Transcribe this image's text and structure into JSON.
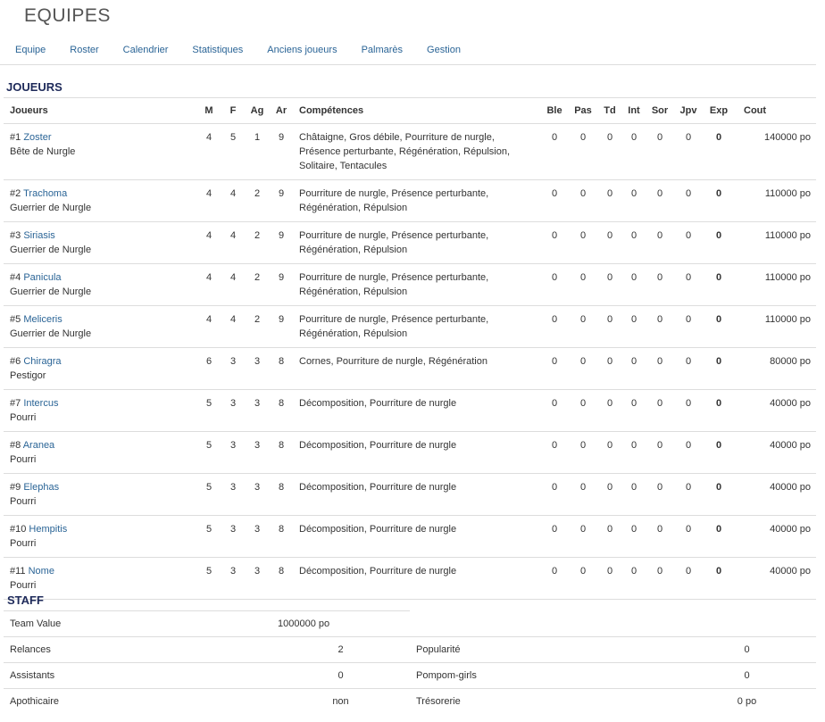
{
  "page": {
    "title": "EQUIPES"
  },
  "nav": {
    "items": [
      "Equipe",
      "Roster",
      "Calendrier",
      "Statistiques",
      "Anciens joueurs",
      "Palmarès",
      "Gestion"
    ]
  },
  "players_section": {
    "title": "JOUEURS",
    "headers": [
      "Joueurs",
      "M",
      "F",
      "Ag",
      "Ar",
      "Compétences",
      "Ble",
      "Pas",
      "Td",
      "Int",
      "Sor",
      "Jpv",
      "Exp",
      "Cout"
    ],
    "rows": [
      {
        "num": "#1",
        "name": "Zoster",
        "position": "Bête de Nurgle",
        "M": "4",
        "F": "5",
        "Ag": "1",
        "Ar": "9",
        "skills": "Châtaigne, Gros débile, Pourriture de nurgle, Présence perturbante, Régénération, Répulsion, Solitaire, Tentacules",
        "Ble": "0",
        "Pas": "0",
        "Td": "0",
        "Int": "0",
        "Sor": "0",
        "Jpv": "0",
        "Exp": "0",
        "cost": "140000 po"
      },
      {
        "num": "#2",
        "name": "Trachoma",
        "position": "Guerrier de Nurgle",
        "M": "4",
        "F": "4",
        "Ag": "2",
        "Ar": "9",
        "skills": "Pourriture de nurgle, Présence perturbante, Régénération, Répulsion",
        "Ble": "0",
        "Pas": "0",
        "Td": "0",
        "Int": "0",
        "Sor": "0",
        "Jpv": "0",
        "Exp": "0",
        "cost": "110000 po"
      },
      {
        "num": "#3",
        "name": "Siriasis",
        "position": "Guerrier de Nurgle",
        "M": "4",
        "F": "4",
        "Ag": "2",
        "Ar": "9",
        "skills": "Pourriture de nurgle, Présence perturbante, Régénération, Répulsion",
        "Ble": "0",
        "Pas": "0",
        "Td": "0",
        "Int": "0",
        "Sor": "0",
        "Jpv": "0",
        "Exp": "0",
        "cost": "110000 po"
      },
      {
        "num": "#4",
        "name": "Panicula",
        "position": "Guerrier de Nurgle",
        "M": "4",
        "F": "4",
        "Ag": "2",
        "Ar": "9",
        "skills": "Pourriture de nurgle, Présence perturbante, Régénération, Répulsion",
        "Ble": "0",
        "Pas": "0",
        "Td": "0",
        "Int": "0",
        "Sor": "0",
        "Jpv": "0",
        "Exp": "0",
        "cost": "110000 po"
      },
      {
        "num": "#5",
        "name": "Meliceris",
        "position": "Guerrier de Nurgle",
        "M": "4",
        "F": "4",
        "Ag": "2",
        "Ar": "9",
        "skills": "Pourriture de nurgle, Présence perturbante, Régénération, Répulsion",
        "Ble": "0",
        "Pas": "0",
        "Td": "0",
        "Int": "0",
        "Sor": "0",
        "Jpv": "0",
        "Exp": "0",
        "cost": "110000 po"
      },
      {
        "num": "#6",
        "name": "Chiragra",
        "position": "Pestigor",
        "M": "6",
        "F": "3",
        "Ag": "3",
        "Ar": "8",
        "skills": "Cornes, Pourriture de nurgle, Régénération",
        "Ble": "0",
        "Pas": "0",
        "Td": "0",
        "Int": "0",
        "Sor": "0",
        "Jpv": "0",
        "Exp": "0",
        "cost": "80000 po"
      },
      {
        "num": "#7",
        "name": "Intercus",
        "position": "Pourri",
        "M": "5",
        "F": "3",
        "Ag": "3",
        "Ar": "8",
        "skills": "Décomposition, Pourriture de nurgle",
        "Ble": "0",
        "Pas": "0",
        "Td": "0",
        "Int": "0",
        "Sor": "0",
        "Jpv": "0",
        "Exp": "0",
        "cost": "40000 po"
      },
      {
        "num": "#8",
        "name": "Aranea",
        "position": "Pourri",
        "M": "5",
        "F": "3",
        "Ag": "3",
        "Ar": "8",
        "skills": "Décomposition, Pourriture de nurgle",
        "Ble": "0",
        "Pas": "0",
        "Td": "0",
        "Int": "0",
        "Sor": "0",
        "Jpv": "0",
        "Exp": "0",
        "cost": "40000 po"
      },
      {
        "num": "#9",
        "name": "Elephas",
        "position": "Pourri",
        "M": "5",
        "F": "3",
        "Ag": "3",
        "Ar": "8",
        "skills": "Décomposition, Pourriture de nurgle",
        "Ble": "0",
        "Pas": "0",
        "Td": "0",
        "Int": "0",
        "Sor": "0",
        "Jpv": "0",
        "Exp": "0",
        "cost": "40000 po"
      },
      {
        "num": "#10",
        "name": "Hempitis",
        "position": "Pourri",
        "M": "5",
        "F": "3",
        "Ag": "3",
        "Ar": "8",
        "skills": "Décomposition, Pourriture de nurgle",
        "Ble": "0",
        "Pas": "0",
        "Td": "0",
        "Int": "0",
        "Sor": "0",
        "Jpv": "0",
        "Exp": "0",
        "cost": "40000 po"
      },
      {
        "num": "#11",
        "name": "Nome",
        "position": "Pourri",
        "M": "5",
        "F": "3",
        "Ag": "3",
        "Ar": "8",
        "skills": "Décomposition, Pourriture de nurgle",
        "Ble": "0",
        "Pas": "0",
        "Td": "0",
        "Int": "0",
        "Sor": "0",
        "Jpv": "0",
        "Exp": "0",
        "cost": "40000 po"
      }
    ]
  },
  "staff_section": {
    "title": "STAFF",
    "team_value": {
      "label": "Team Value",
      "value": "1000000 po"
    },
    "rows": [
      {
        "left_label": "Relances",
        "left_value": "2",
        "right_label": "Popularité",
        "right_value": "0"
      },
      {
        "left_label": "Assistants",
        "left_value": "0",
        "right_label": "Pompom-girls",
        "right_value": "0"
      },
      {
        "left_label": "Apothicaire",
        "left_value": "non",
        "right_label": "Trésorerie",
        "right_value": "0 po"
      }
    ]
  }
}
